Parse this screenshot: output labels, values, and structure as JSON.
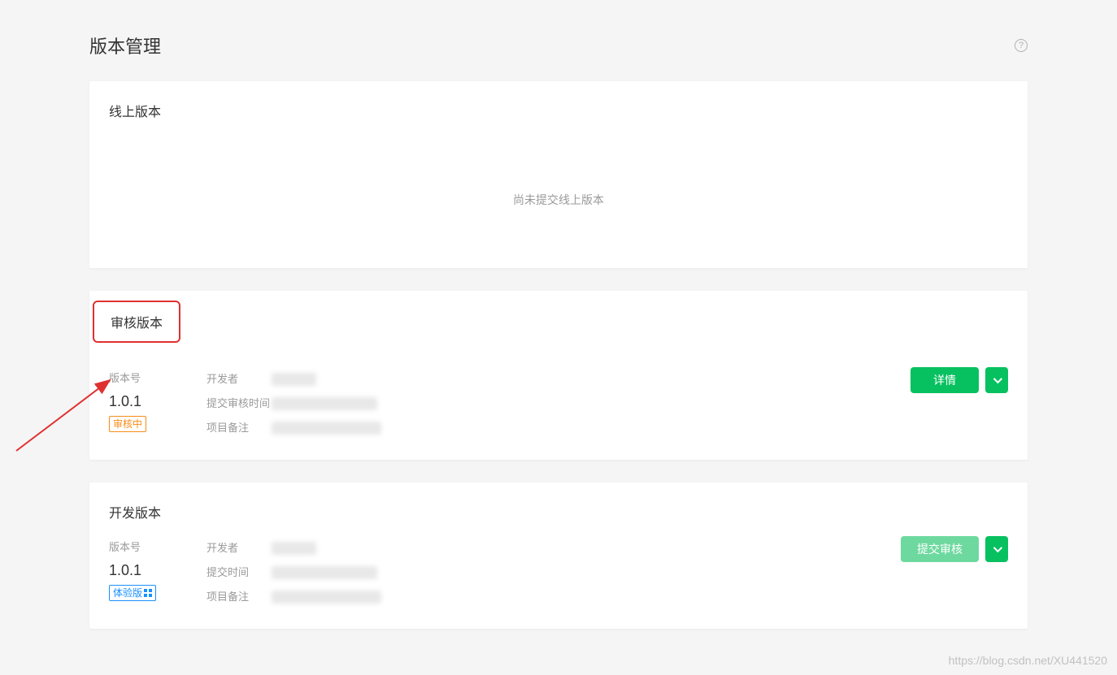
{
  "page": {
    "title": "版本管理",
    "helpLabel": "?"
  },
  "onlineSection": {
    "title": "线上版本",
    "emptyText": "尚未提交线上版本"
  },
  "reviewSection": {
    "title": "审核版本",
    "fields": {
      "versionLabel": "版本号",
      "versionValue": "1.0.1",
      "badge": "审核中",
      "developerLabel": "开发者",
      "submitTimeLabel": "提交审核时间",
      "noteLabel": "项目备注"
    },
    "actions": {
      "primary": "详情"
    }
  },
  "devSection": {
    "title": "开发版本",
    "fields": {
      "versionLabel": "版本号",
      "versionValue": "1.0.1",
      "badgeText": "体验版",
      "developerLabel": "开发者",
      "submitTimeLabel": "提交时间",
      "noteLabel": "项目备注"
    },
    "actions": {
      "primary": "提交审核"
    }
  },
  "watermark": "https://blog.csdn.net/XU441520"
}
